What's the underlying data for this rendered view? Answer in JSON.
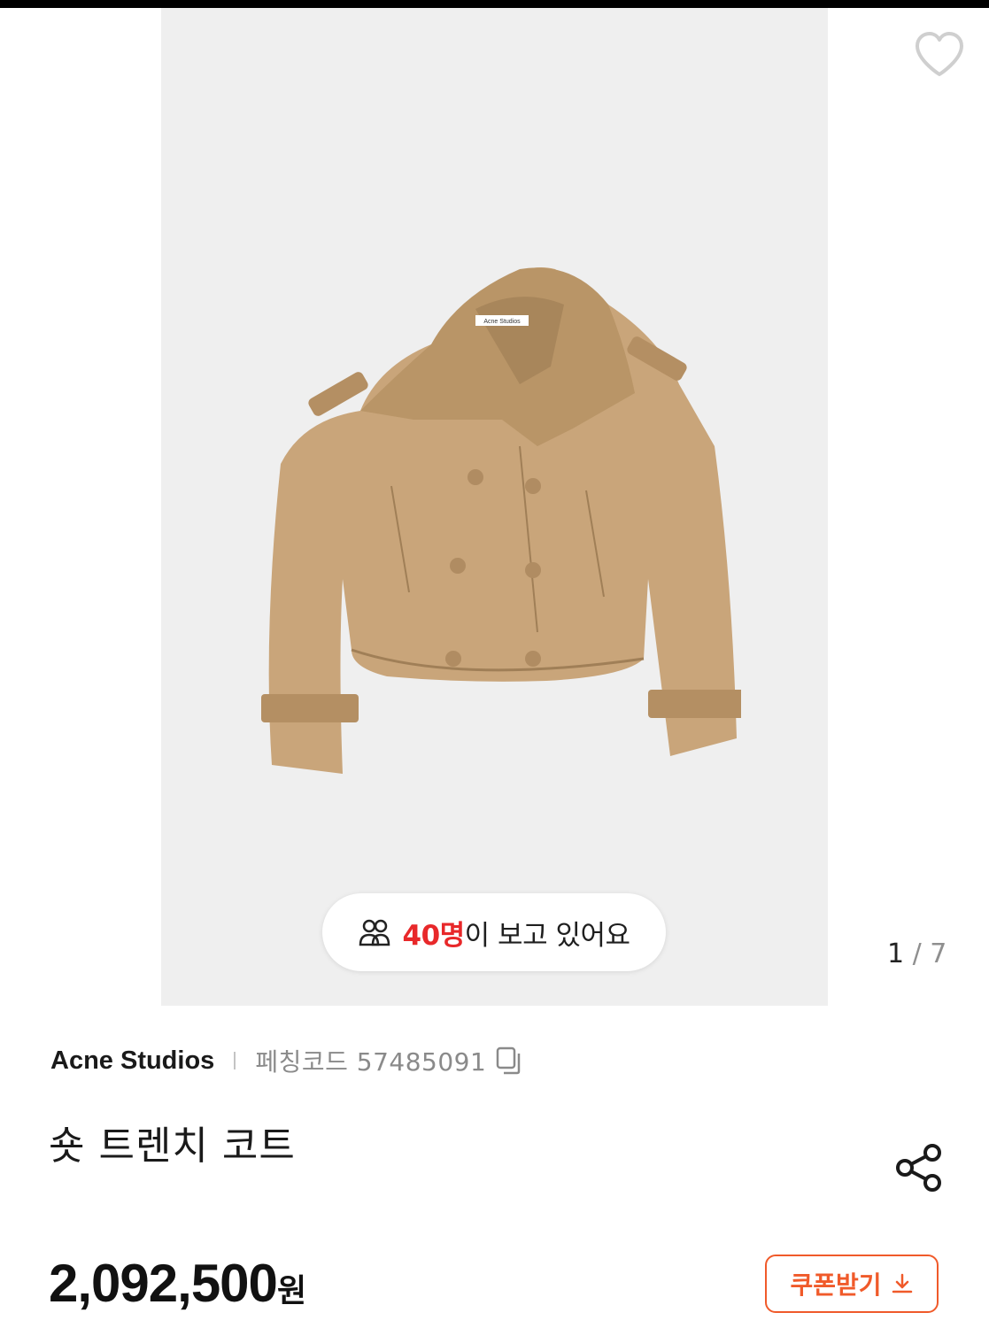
{
  "gallery": {
    "viewers_count": "40명",
    "viewers_suffix": "이 보고 있어요",
    "label_tag": "Acne Studios",
    "page_current": "1",
    "page_sep": "/",
    "page_total": "7"
  },
  "product": {
    "brand": "Acne Studios",
    "code": "페칭코드 57485091",
    "title": "숏 트렌치 코트",
    "price": "2,092,500",
    "currency": "원"
  },
  "actions": {
    "coupon_label": "쿠폰받기"
  },
  "colors": {
    "accent": "#f05a2a",
    "viewer_count": "#e8282a",
    "gallery_bg": "#efefef",
    "jacket": "#c9a57a"
  },
  "icons": [
    "heart-icon",
    "people-icon",
    "copy-icon",
    "share-icon",
    "download-icon"
  ]
}
